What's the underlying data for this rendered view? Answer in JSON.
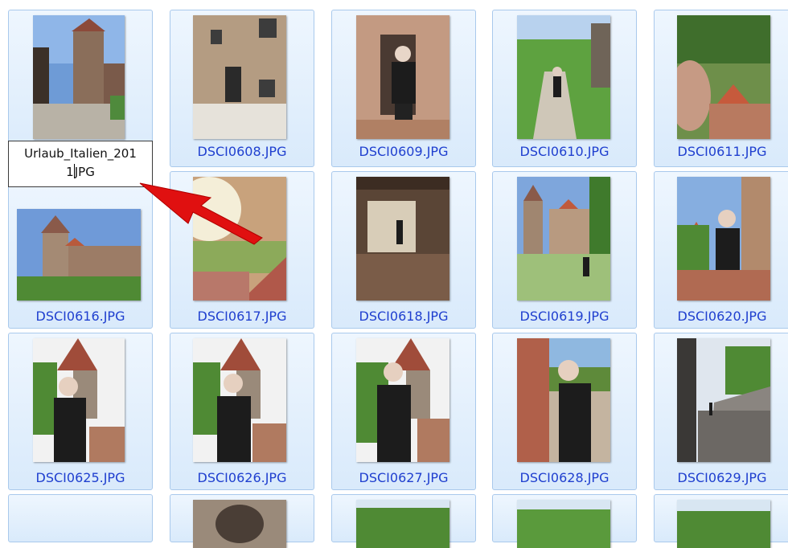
{
  "rename": {
    "line1": "Urlaub_Italien_201",
    "line2_before": "1",
    "line2_after": "JPG"
  },
  "files": [
    {
      "name": "",
      "icon": "castle-tower-photo",
      "selected": true
    },
    {
      "name": "DSCI0608.JPG",
      "icon": "person-street-photo"
    },
    {
      "name": "DSCI0609.JPG",
      "icon": "person-doorway-photo"
    },
    {
      "name": "DSCI0610.JPG",
      "icon": "person-garden-path-photo"
    },
    {
      "name": "DSCI0611.JPG",
      "icon": "selfie-rooftops-photo"
    },
    {
      "name": "DSCI0616.JPG",
      "icon": "castle-landscape-photo"
    },
    {
      "name": "DSCI0617.JPG",
      "icon": "castle-stairs-photo"
    },
    {
      "name": "DSCI0618.JPG",
      "icon": "archway-stairs-photo"
    },
    {
      "name": "DSCI0619.JPG",
      "icon": "castle-towers-photo"
    },
    {
      "name": "DSCI0620.JPG",
      "icon": "person-wall-photo"
    },
    {
      "name": "DSCI0625.JPG",
      "icon": "person-tower-photo"
    },
    {
      "name": "DSCI0626.JPG",
      "icon": "person-tower-photo"
    },
    {
      "name": "DSCI0627.JPG",
      "icon": "person-tower-photo"
    },
    {
      "name": "DSCI0628.JPG",
      "icon": "person-brick-wall-photo"
    },
    {
      "name": "DSCI0629.JPG",
      "icon": "castle-walkway-photo"
    },
    {
      "name": "",
      "icon": "blank-thumbnail"
    },
    {
      "name": "",
      "icon": "partial-photo"
    },
    {
      "name": "",
      "icon": "partial-photo"
    },
    {
      "name": "",
      "icon": "partial-photo"
    },
    {
      "name": "",
      "icon": "partial-photo"
    }
  ],
  "annotation": {
    "icon": "red-arrow-icon",
    "color": "#e01010"
  },
  "colors": {
    "label": "#1f3fcf",
    "tile_border": "#a9c9ec",
    "tile_bg": "#e3effc"
  }
}
